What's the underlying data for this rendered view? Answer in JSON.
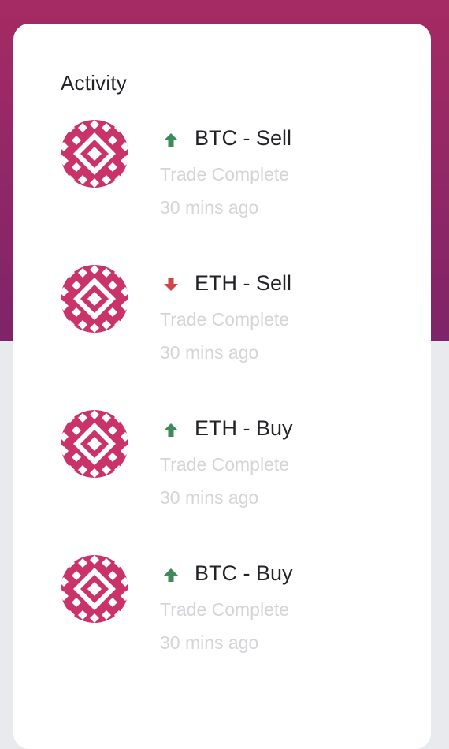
{
  "activity": {
    "title": "Activity",
    "items": [
      {
        "label": "BTC - Sell",
        "status": "Trade Complete",
        "time": "30 mins ago",
        "direction": "up"
      },
      {
        "label": "ETH - Sell",
        "status": "Trade Complete",
        "time": "30 mins ago",
        "direction": "down"
      },
      {
        "label": "ETH - Buy",
        "status": "Trade Complete",
        "time": "30 mins ago",
        "direction": "up"
      },
      {
        "label": "BTC - Buy",
        "status": "Trade Complete",
        "time": "30 mins ago",
        "direction": "up"
      }
    ]
  },
  "colors": {
    "header_top": "#a52b63",
    "header_bottom": "#7e2468",
    "avatar": "#c9336a",
    "arrow_up": "#3e8a5a",
    "arrow_down": "#d24545",
    "muted_text": "#d4d5d8",
    "primary_text": "#222326"
  },
  "icons": {
    "avatar": "geometric-pattern-avatar",
    "up": "arrow-up-icon",
    "down": "arrow-down-icon"
  }
}
